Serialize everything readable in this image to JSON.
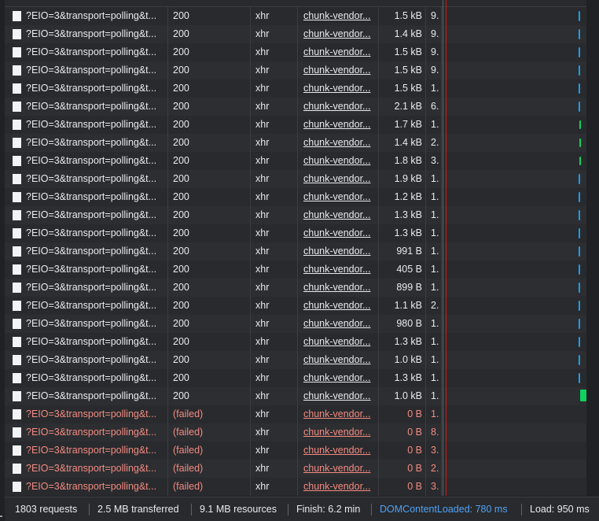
{
  "colors": {
    "bar_blue": "#1a9cf0",
    "bar_green": "#0fd25f",
    "load_line": "#c5221f",
    "failed_text": "#f28b82",
    "domcontent": "#4fa3f7"
  },
  "requests": [
    {
      "name": "?EIO=3&transport=polling&t...",
      "status": "200",
      "type": "xhr",
      "initiator": "chunk-vendor...",
      "size": "1.5 kB",
      "time": "9.",
      "failed": false,
      "bar": "blue"
    },
    {
      "name": "?EIO=3&transport=polling&t...",
      "status": "200",
      "type": "xhr",
      "initiator": "chunk-vendor...",
      "size": "1.4 kB",
      "time": "9.",
      "failed": false,
      "bar": "blue"
    },
    {
      "name": "?EIO=3&transport=polling&t...",
      "status": "200",
      "type": "xhr",
      "initiator": "chunk-vendor...",
      "size": "1.5 kB",
      "time": "9.",
      "failed": false,
      "bar": "blue"
    },
    {
      "name": "?EIO=3&transport=polling&t...",
      "status": "200",
      "type": "xhr",
      "initiator": "chunk-vendor...",
      "size": "1.5 kB",
      "time": "9.",
      "failed": false,
      "bar": "blue"
    },
    {
      "name": "?EIO=3&transport=polling&t...",
      "status": "200",
      "type": "xhr",
      "initiator": "chunk-vendor...",
      "size": "1.5 kB",
      "time": "1.",
      "failed": false,
      "bar": "blue"
    },
    {
      "name": "?EIO=3&transport=polling&t...",
      "status": "200",
      "type": "xhr",
      "initiator": "chunk-vendor...",
      "size": "2.1 kB",
      "time": "6.",
      "failed": false,
      "bar": "blue"
    },
    {
      "name": "?EIO=3&transport=polling&t...",
      "status": "200",
      "type": "xhr",
      "initiator": "chunk-vendor...",
      "size": "1.7 kB",
      "time": "1.",
      "failed": false,
      "bar": "green"
    },
    {
      "name": "?EIO=3&transport=polling&t...",
      "status": "200",
      "type": "xhr",
      "initiator": "chunk-vendor...",
      "size": "1.4 kB",
      "time": "2.",
      "failed": false,
      "bar": "green"
    },
    {
      "name": "?EIO=3&transport=polling&t...",
      "status": "200",
      "type": "xhr",
      "initiator": "chunk-vendor...",
      "size": "1.8 kB",
      "time": "3.",
      "failed": false,
      "bar": "green"
    },
    {
      "name": "?EIO=3&transport=polling&t...",
      "status": "200",
      "type": "xhr",
      "initiator": "chunk-vendor...",
      "size": "1.9 kB",
      "time": "1.",
      "failed": false,
      "bar": "blue"
    },
    {
      "name": "?EIO=3&transport=polling&t...",
      "status": "200",
      "type": "xhr",
      "initiator": "chunk-vendor...",
      "size": "1.2 kB",
      "time": "1.",
      "failed": false,
      "bar": "blue"
    },
    {
      "name": "?EIO=3&transport=polling&t...",
      "status": "200",
      "type": "xhr",
      "initiator": "chunk-vendor...",
      "size": "1.3 kB",
      "time": "1.",
      "failed": false,
      "bar": "blue"
    },
    {
      "name": "?EIO=3&transport=polling&t...",
      "status": "200",
      "type": "xhr",
      "initiator": "chunk-vendor...",
      "size": "1.3 kB",
      "time": "1.",
      "failed": false,
      "bar": "blue"
    },
    {
      "name": "?EIO=3&transport=polling&t...",
      "status": "200",
      "type": "xhr",
      "initiator": "chunk-vendor...",
      "size": "991 B",
      "time": "1.",
      "failed": false,
      "bar": "blue"
    },
    {
      "name": "?EIO=3&transport=polling&t...",
      "status": "200",
      "type": "xhr",
      "initiator": "chunk-vendor...",
      "size": "405 B",
      "time": "1.",
      "failed": false,
      "bar": "blue"
    },
    {
      "name": "?EIO=3&transport=polling&t...",
      "status": "200",
      "type": "xhr",
      "initiator": "chunk-vendor...",
      "size": "899 B",
      "time": "1.",
      "failed": false,
      "bar": "blue"
    },
    {
      "name": "?EIO=3&transport=polling&t...",
      "status": "200",
      "type": "xhr",
      "initiator": "chunk-vendor...",
      "size": "1.1 kB",
      "time": "2.",
      "failed": false,
      "bar": "blue"
    },
    {
      "name": "?EIO=3&transport=polling&t...",
      "status": "200",
      "type": "xhr",
      "initiator": "chunk-vendor...",
      "size": "980 B",
      "time": "1.",
      "failed": false,
      "bar": "blue"
    },
    {
      "name": "?EIO=3&transport=polling&t...",
      "status": "200",
      "type": "xhr",
      "initiator": "chunk-vendor...",
      "size": "1.3 kB",
      "time": "1.",
      "failed": false,
      "bar": "blue"
    },
    {
      "name": "?EIO=3&transport=polling&t...",
      "status": "200",
      "type": "xhr",
      "initiator": "chunk-vendor...",
      "size": "1.0 kB",
      "time": "1.",
      "failed": false,
      "bar": "blue"
    },
    {
      "name": "?EIO=3&transport=polling&t...",
      "status": "200",
      "type": "xhr",
      "initiator": "chunk-vendor...",
      "size": "1.3 kB",
      "time": "1.",
      "failed": false,
      "bar": "blue"
    },
    {
      "name": "?EIO=3&transport=polling&t...",
      "status": "200",
      "type": "xhr",
      "initiator": "chunk-vendor...",
      "size": "1.0 kB",
      "time": "1.",
      "failed": false,
      "bar": "green-wide"
    },
    {
      "name": "?EIO=3&transport=polling&t...",
      "status": "(failed)",
      "type": "xhr",
      "initiator": "chunk-vendor...",
      "size": "0 B",
      "time": "1.",
      "failed": true,
      "bar": "none"
    },
    {
      "name": "?EIO=3&transport=polling&t...",
      "status": "(failed)",
      "type": "xhr",
      "initiator": "chunk-vendor...",
      "size": "0 B",
      "time": "8.",
      "failed": true,
      "bar": "none"
    },
    {
      "name": "?EIO=3&transport=polling&t...",
      "status": "(failed)",
      "type": "xhr",
      "initiator": "chunk-vendor...",
      "size": "0 B",
      "time": "3.",
      "failed": true,
      "bar": "none"
    },
    {
      "name": "?EIO=3&transport=polling&t...",
      "status": "(failed)",
      "type": "xhr",
      "initiator": "chunk-vendor...",
      "size": "0 B",
      "time": "2.",
      "failed": true,
      "bar": "none"
    },
    {
      "name": "?EIO=3&transport=polling&t...",
      "status": "(failed)",
      "type": "xhr",
      "initiator": "chunk-vendor...",
      "size": "0 B",
      "time": "3.",
      "failed": true,
      "bar": "none"
    }
  ],
  "summary": {
    "requests": "1803 requests",
    "transferred": "2.5 MB transferred",
    "resources": "9.1 MB resources",
    "finish": "Finish: 6.2 min",
    "domcontentloaded": "DOMContentLoaded: 780 ms",
    "load": "Load: 950 ms"
  }
}
